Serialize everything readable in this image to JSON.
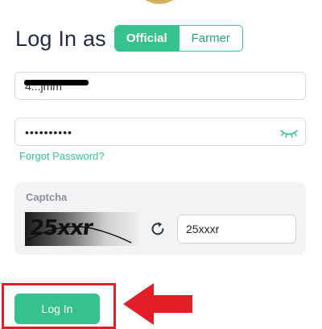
{
  "login": {
    "title": "Log In as",
    "role_options": [
      "Official",
      "Farmer"
    ],
    "selected_role": "Official",
    "username_value": "4...jmm",
    "password_value": "••••••••••",
    "forgot_password": "Forgot Password?",
    "captcha": {
      "label": "Captcha",
      "image_text": "25xxr",
      "input_value": "25xxxr"
    },
    "submit_label": "Log In"
  },
  "colors": {
    "accent": "#36c28e",
    "annotation_red": "#e21f26"
  },
  "icons": {
    "password_toggle": "eye-closed-icon",
    "captcha_refresh": "refresh-icon",
    "annotation": "arrow-left-icon"
  }
}
